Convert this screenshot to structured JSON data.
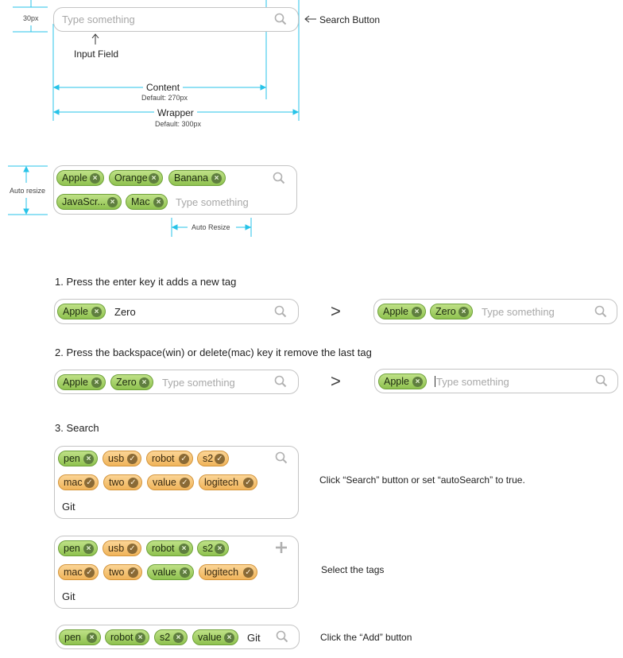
{
  "anatomy": {
    "height_label": "30px",
    "placeholder": "Type something",
    "search_button_label": "Search Button",
    "input_field_label": "Input Field",
    "content_label": "Content",
    "content_default": "Default: 270px",
    "wrapper_label": "Wrapper",
    "wrapper_default": "Default: 300px"
  },
  "auto_resize_demo": {
    "side_label": "Auto resize",
    "bottom_label": "Auto Resize",
    "row1": [
      "Apple",
      "Orange",
      "Banana"
    ],
    "row2": [
      "JavaScr...",
      "Mac"
    ],
    "placeholder": "Type something"
  },
  "step1": {
    "heading": "1. Press the enter key it adds a new tag",
    "before_tags": [
      "Apple"
    ],
    "before_typed": "Zero",
    "arrow": ">",
    "after_tags": [
      "Apple",
      "Zero"
    ],
    "after_placeholder": "Type something"
  },
  "step2": {
    "heading": "2. Press the backspace(win) or delete(mac) key it remove the last tag",
    "before_tags": [
      "Apple",
      "Zero"
    ],
    "before_placeholder": "Type something",
    "arrow": ">",
    "after_tags": [
      "Apple"
    ],
    "after_placeholder": "Type something"
  },
  "step3": {
    "heading": "3. Search",
    "box_a": {
      "row1": [
        "pen",
        "usb",
        "robot",
        "s2"
      ],
      "row2": [
        "mac",
        "two",
        "value",
        "logitech"
      ],
      "typed": "Git",
      "note": "Click “Search” button or set “autoSearch” to true."
    },
    "box_b": {
      "row1": [
        "pen",
        "usb",
        "robot",
        "s2"
      ],
      "row2": [
        "mac",
        "two",
        "value",
        "logitech"
      ],
      "typed": "Git",
      "note": "Select the tags"
    },
    "box_c": {
      "tags": [
        "pen",
        "robot",
        "s2",
        "value"
      ],
      "typed": "Git",
      "note": "Click the “Add” button"
    }
  },
  "icons": {
    "search": "search-icon",
    "remove": "close-icon",
    "check": "check-icon",
    "add": "plus-icon"
  },
  "colors": {
    "tag_green": "#a6d16a",
    "tag_orange": "#f4c06f",
    "dimension_line": "#27c3e8",
    "border": "#c4c4c4"
  }
}
